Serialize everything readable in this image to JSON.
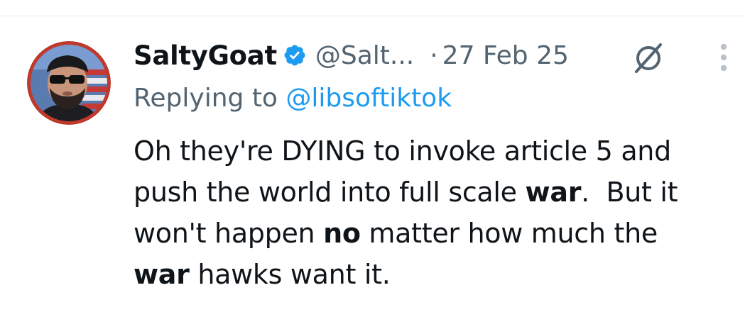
{
  "tweet": {
    "author": {
      "display_name": "SaltyGoat",
      "handle": "@Salt...",
      "verified": true,
      "avatar_icon": "profile-photo-bearded-man-sunglasses-flag"
    },
    "separator": "·",
    "date": "27 Feb 25",
    "grok_icon": "grok-slash-circle-icon",
    "more_icon": "vertical-ellipsis-icon",
    "reply": {
      "prefix": "Replying to",
      "target": "@libsoftiktok"
    },
    "text": {
      "line1": "Oh they're DYING to invoke article 5 and",
      "line2_a": "push the world into full scale ",
      "line2_b": "war",
      "line2_c": ".  But it",
      "line3_a": "won't happen ",
      "line3_b": "no",
      "line3_c": " matter how much the",
      "line4_a": "war",
      "line4_b": " hawks want it."
    },
    "colors": {
      "verified_badge": "#1d9bf0",
      "link": "#1d9bf0",
      "secondary_text": "#536471",
      "primary_text": "#0f1419",
      "avatar_ring": "#c0392b"
    }
  }
}
